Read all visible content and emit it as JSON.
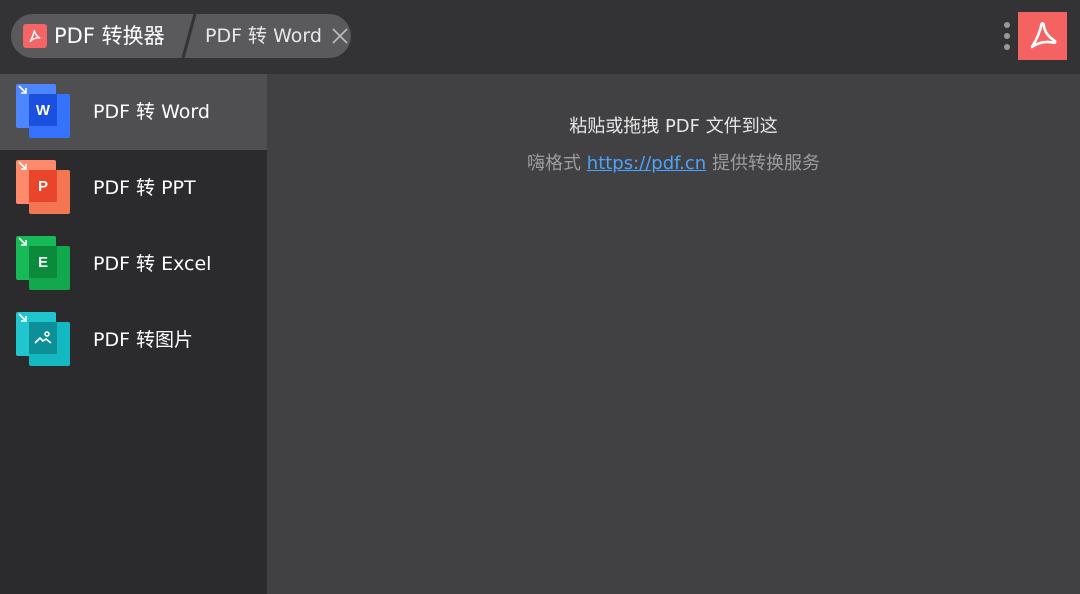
{
  "header": {
    "app_title": "PDF 转换器",
    "active_tab": "PDF 转 Word",
    "brand_color": "#f56262"
  },
  "sidebar": {
    "items": [
      {
        "label": "PDF 转 Word",
        "icon": "word-doc-icon",
        "letter": "W",
        "color": "#2f6bff",
        "active": true
      },
      {
        "label": "PDF 转 PPT",
        "icon": "ppt-doc-icon",
        "letter": "P",
        "color": "#f06a47",
        "active": false
      },
      {
        "label": "PDF 转 Excel",
        "icon": "excel-doc-icon",
        "letter": "E",
        "color": "#10a54b",
        "active": false
      },
      {
        "label": "PDF 转图片",
        "icon": "image-doc-icon",
        "letter": "",
        "color": "#12b5bd",
        "active": false
      }
    ]
  },
  "main": {
    "drop_hint": "粘贴或拖拽 PDF 文件到这",
    "service_prefix": "嗨格式",
    "service_link": "https://pdf.cn",
    "service_suffix": "提供转换服务"
  }
}
